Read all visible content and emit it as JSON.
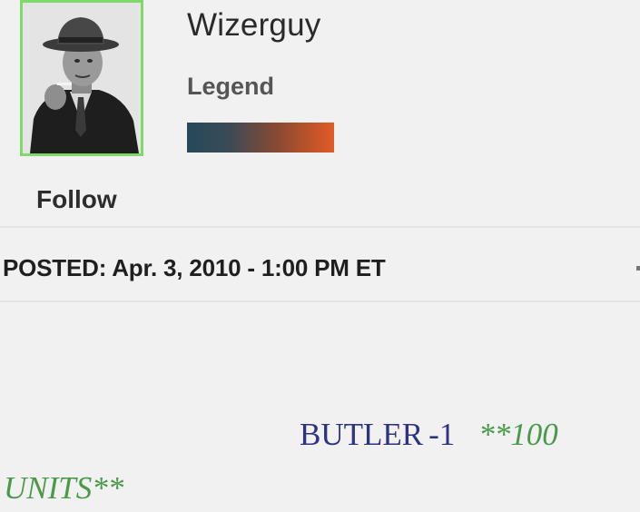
{
  "user": {
    "name": "Wizerguy",
    "rank_title": "Legend",
    "avatar_icon": "user-avatar-photo",
    "avatar_border_color": "#7ed96a",
    "rank_bar_colors": [
      "#26495a",
      "#e35a25"
    ]
  },
  "actions": {
    "follow_label": "Follow"
  },
  "post": {
    "posted_label": "POSTED: Apr. 3, 2010 - 1:00 PM ET",
    "pick_team": "BUTLER",
    "pick_line": "-1",
    "units_part1": "**100",
    "units_part2": "UNITS**",
    "team_color": "#2f3280",
    "units_color": "#4a9a4a"
  }
}
